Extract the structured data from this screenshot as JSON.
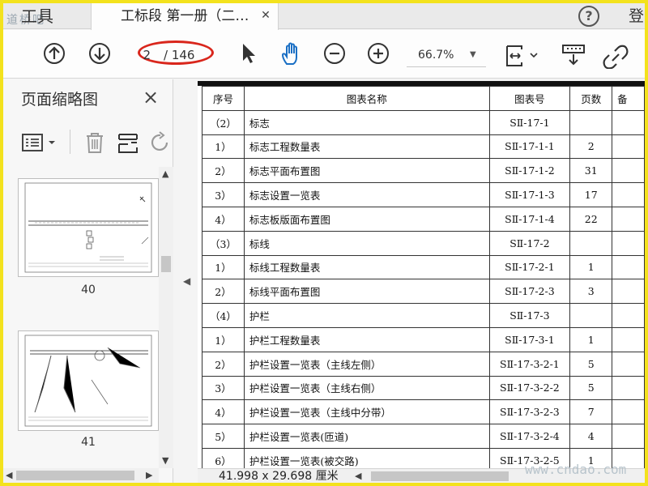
{
  "tabbar": {
    "tools_tab": "工具",
    "doc_tab_title": "工标段 第一册（二…",
    "help_icon": "?",
    "login_label": "登",
    "watermark_top": "道桥吧"
  },
  "toolbar": {
    "page_current": "2",
    "page_total": "/ 146",
    "zoom": "66.7%",
    "icons": [
      "arrow-up-circle-icon",
      "arrow-down-circle-icon",
      "pointer-icon",
      "hand-icon",
      "zoom-out-icon",
      "zoom-in-icon",
      "fit-page-icon",
      "scroll-mode-icon",
      "link-icon"
    ],
    "highlight_color": "#d9261c"
  },
  "sidebar": {
    "title": "页面缩略图",
    "close_icon": "×",
    "thumbnails": [
      {
        "label": "40"
      },
      {
        "label": "41"
      }
    ]
  },
  "table": {
    "headers": {
      "seq": "序号",
      "name": "图表名称",
      "code": "图表号",
      "pages": "页数",
      "remark": "备"
    },
    "rows": [
      {
        "seq": "（2）",
        "name": "标志",
        "code": "SⅡ-17-1",
        "pages": ""
      },
      {
        "seq": "1）",
        "name": "标志工程数量表",
        "code": "SⅡ-17-1-1",
        "pages": "2"
      },
      {
        "seq": "2）",
        "name": "标志平面布置图",
        "code": "SⅡ-17-1-2",
        "pages": "31"
      },
      {
        "seq": "3）",
        "name": "标志设置一览表",
        "code": "SⅡ-17-1-3",
        "pages": "17"
      },
      {
        "seq": "4）",
        "name": "标志板版面布置图",
        "code": "SⅡ-17-1-4",
        "pages": "22"
      },
      {
        "seq": "（3）",
        "name": "标线",
        "code": "SⅡ-17-2",
        "pages": ""
      },
      {
        "seq": "1）",
        "name": "标线工程数量表",
        "code": "SⅡ-17-2-1",
        "pages": "1"
      },
      {
        "seq": "2）",
        "name": "标线平面布置图",
        "code": "SⅡ-17-2-3",
        "pages": "3"
      },
      {
        "seq": "（4）",
        "name": "护栏",
        "code": "SⅡ-17-3",
        "pages": ""
      },
      {
        "seq": "1）",
        "name": "护栏工程数量表",
        "code": "SⅡ-17-3-1",
        "pages": "1"
      },
      {
        "seq": "2）",
        "name": "护栏设置一览表（主线左侧）",
        "code": "SⅡ-17-3-2-1",
        "pages": "5"
      },
      {
        "seq": "3）",
        "name": "护栏设置一览表（主线右侧）",
        "code": "SⅡ-17-3-2-2",
        "pages": "5"
      },
      {
        "seq": "4）",
        "name": "护栏设置一览表（主线中分带）",
        "code": "SⅡ-17-3-2-3",
        "pages": "7"
      },
      {
        "seq": "5）",
        "name": "护栏设置一览表(匝道)",
        "code": "SⅡ-17-3-2-4",
        "pages": "4"
      },
      {
        "seq": "6）",
        "name": "护栏设置一览表(被交路)",
        "code": "SⅡ-17-3-2-5",
        "pages": "1"
      }
    ]
  },
  "statusbar": {
    "dimensions": "41.998 x 29.698 厘米",
    "watermark_bottom": "www.cndao.com"
  }
}
